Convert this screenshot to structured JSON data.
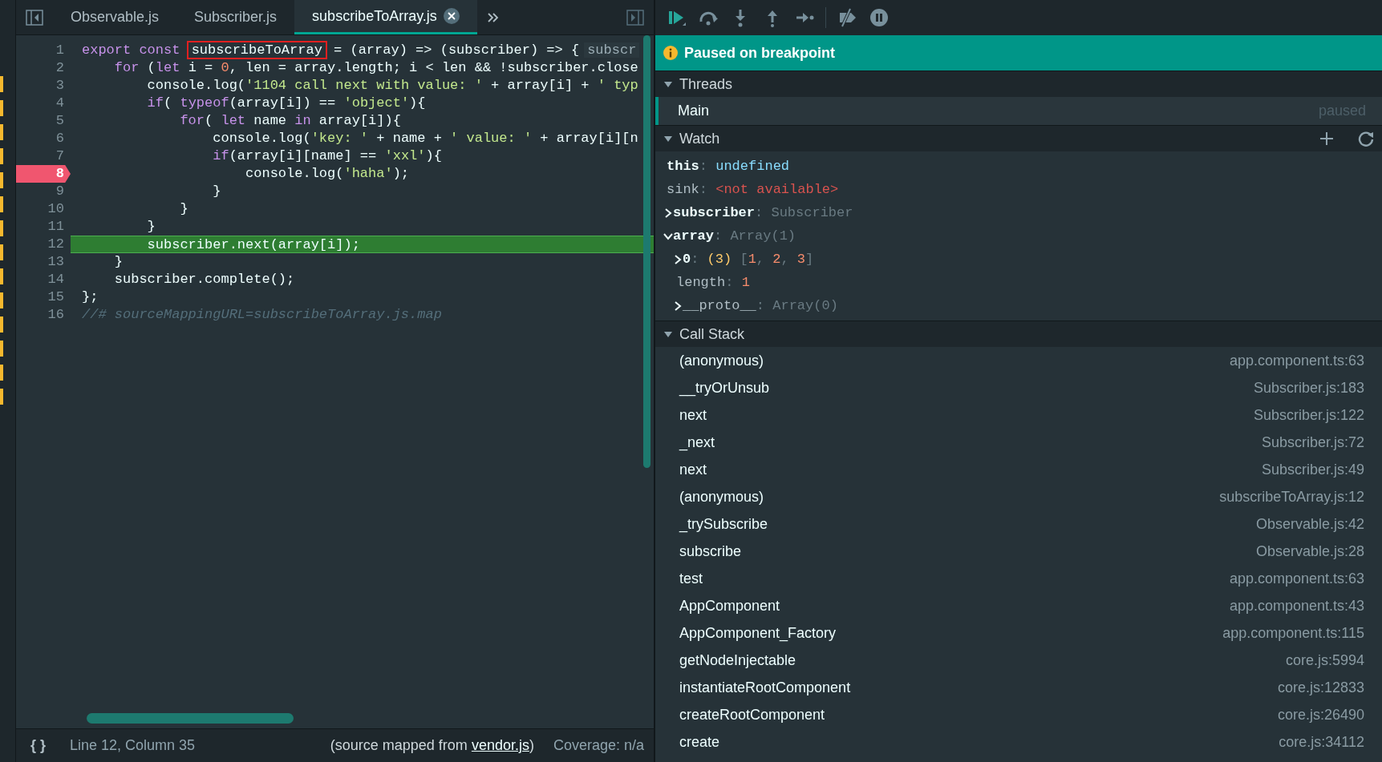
{
  "editor": {
    "tabs": [
      {
        "label": "Observable.js",
        "selected": false,
        "closable": false
      },
      {
        "label": "Subscriber.js",
        "selected": false,
        "closable": false
      },
      {
        "label": "subscribeToArray.js",
        "selected": true,
        "closable": true
      }
    ],
    "lines": [
      {
        "number": "1",
        "breakpoint": false,
        "current": false,
        "tokens": [
          {
            "kind": "keyword",
            "text": "export const "
          },
          {
            "kind": "boxed",
            "text": "subscribeToArray"
          },
          {
            "kind": "plain",
            "text": " = (array) => (subscriber) => {"
          },
          {
            "kind": "hint",
            "text": "subscr"
          }
        ]
      },
      {
        "number": "2",
        "breakpoint": false,
        "current": false,
        "tokens": [
          {
            "kind": "keyword",
            "text": "    for"
          },
          {
            "kind": "plain",
            "text": " ("
          },
          {
            "kind": "keyword",
            "text": "let"
          },
          {
            "kind": "plain",
            "text": " i = "
          },
          {
            "kind": "number",
            "text": "0"
          },
          {
            "kind": "plain",
            "text": ", len = array.length; i < len && !subscriber.close"
          }
        ]
      },
      {
        "number": "3",
        "breakpoint": false,
        "current": false,
        "tokens": [
          {
            "kind": "plain",
            "text": "        console.log("
          },
          {
            "kind": "string",
            "text": "'1104 call next with value: '"
          },
          {
            "kind": "plain",
            "text": " + array[i] + "
          },
          {
            "kind": "string",
            "text": "' typ"
          }
        ]
      },
      {
        "number": "4",
        "breakpoint": false,
        "current": false,
        "tokens": [
          {
            "kind": "keyword",
            "text": "        if"
          },
          {
            "kind": "plain",
            "text": "( "
          },
          {
            "kind": "keyword",
            "text": "typeof"
          },
          {
            "kind": "plain",
            "text": "(array[i]) == "
          },
          {
            "kind": "string",
            "text": "'object'"
          },
          {
            "kind": "plain",
            "text": "){"
          }
        ]
      },
      {
        "number": "5",
        "breakpoint": false,
        "current": false,
        "tokens": [
          {
            "kind": "keyword",
            "text": "            for"
          },
          {
            "kind": "plain",
            "text": "( "
          },
          {
            "kind": "keyword",
            "text": "let"
          },
          {
            "kind": "plain",
            "text": " name "
          },
          {
            "kind": "keyword",
            "text": "in"
          },
          {
            "kind": "plain",
            "text": " array[i]){"
          }
        ]
      },
      {
        "number": "6",
        "breakpoint": false,
        "current": false,
        "tokens": [
          {
            "kind": "plain",
            "text": "                console.log("
          },
          {
            "kind": "string",
            "text": "'key: '"
          },
          {
            "kind": "plain",
            "text": " + name + "
          },
          {
            "kind": "string",
            "text": "' value: '"
          },
          {
            "kind": "plain",
            "text": " + array[i][n"
          }
        ]
      },
      {
        "number": "7",
        "breakpoint": false,
        "current": false,
        "tokens": [
          {
            "kind": "keyword",
            "text": "                if"
          },
          {
            "kind": "plain",
            "text": "(array[i][name] == "
          },
          {
            "kind": "string",
            "text": "'xxl'"
          },
          {
            "kind": "plain",
            "text": "){"
          }
        ]
      },
      {
        "number": "8",
        "breakpoint": true,
        "current": false,
        "tokens": [
          {
            "kind": "plain",
            "text": "                    console.log("
          },
          {
            "kind": "string",
            "text": "'haha'"
          },
          {
            "kind": "plain",
            "text": ");"
          }
        ]
      },
      {
        "number": "9",
        "breakpoint": false,
        "current": false,
        "tokens": [
          {
            "kind": "plain",
            "text": "                }"
          }
        ]
      },
      {
        "number": "10",
        "breakpoint": false,
        "current": false,
        "tokens": [
          {
            "kind": "plain",
            "text": "            }"
          }
        ]
      },
      {
        "number": "11",
        "breakpoint": false,
        "current": false,
        "tokens": [
          {
            "kind": "plain",
            "text": "        }"
          }
        ]
      },
      {
        "number": "12",
        "breakpoint": false,
        "current": true,
        "tokens": [
          {
            "kind": "plain",
            "text": "        subscriber.next(array[i]);"
          }
        ]
      },
      {
        "number": "13",
        "breakpoint": false,
        "current": false,
        "tokens": [
          {
            "kind": "plain",
            "text": "    }"
          }
        ]
      },
      {
        "number": "14",
        "breakpoint": false,
        "current": false,
        "tokens": [
          {
            "kind": "plain",
            "text": "    subscriber.complete();"
          }
        ]
      },
      {
        "number": "15",
        "breakpoint": false,
        "current": false,
        "tokens": [
          {
            "kind": "plain",
            "text": "};"
          }
        ]
      },
      {
        "number": "16",
        "breakpoint": false,
        "current": false,
        "tokens": [
          {
            "kind": "comment",
            "text": "//# sourceMappingURL=subscribeToArray.js.map"
          }
        ]
      }
    ],
    "status_bar": {
      "format_button": "{ }",
      "position": "Line 12, Column 35",
      "source_prefix": "(source mapped from ",
      "source_link": "vendor.js",
      "source_suffix": ")",
      "coverage": "Coverage: n/a"
    }
  },
  "debugger": {
    "banner": "Paused on breakpoint",
    "threads": {
      "title": "Threads",
      "expanded": true,
      "items": [
        {
          "name": "Main",
          "status": "paused",
          "selected": true
        }
      ]
    },
    "watch": {
      "title": "Watch",
      "expanded": true,
      "items": [
        {
          "name": "this",
          "value": [
            {
              "kind": "punct",
              "text": ": "
            },
            {
              "kind": "undefined",
              "text": "undefined"
            }
          ]
        },
        {
          "name": "sink",
          "dim": true,
          "value": [
            {
              "kind": "punct",
              "text": ": "
            },
            {
              "kind": "error",
              "text": "<not available>"
            }
          ]
        },
        {
          "name": "subscriber",
          "expanded": false,
          "value": [
            {
              "kind": "punct",
              "text": ": "
            },
            {
              "kind": "type",
              "text": "Subscriber"
            }
          ]
        },
        {
          "name": "array",
          "expanded": true,
          "value": [
            {
              "kind": "punct",
              "text": ": "
            },
            {
              "kind": "type",
              "text": "Array(1)"
            }
          ],
          "children": [
            {
              "name": "0",
              "expanded": false,
              "value": [
                {
                  "kind": "punct",
                  "text": ": "
                },
                {
                  "kind": "count",
                  "text": "(3)"
                },
                {
                  "kind": "punct",
                  "text": " ["
                },
                {
                  "kind": "number",
                  "text": "1"
                },
                {
                  "kind": "punct",
                  "text": ", "
                },
                {
                  "kind": "number",
                  "text": "2"
                },
                {
                  "kind": "punct",
                  "text": ", "
                },
                {
                  "kind": "number",
                  "text": "3"
                },
                {
                  "kind": "punct",
                  "text": "]"
                }
              ]
            },
            {
              "name": "length",
              "dim": true,
              "value": [
                {
                  "kind": "punct",
                  "text": ": "
                },
                {
                  "kind": "number",
                  "text": "1"
                }
              ]
            },
            {
              "name": "__proto__",
              "expanded": false,
              "dim": true,
              "value": [
                {
                  "kind": "punct",
                  "text": ": "
                },
                {
                  "kind": "type",
                  "text": "Array(0)"
                }
              ]
            }
          ]
        }
      ]
    },
    "call_stack": {
      "title": "Call Stack",
      "expanded": true,
      "frames": [
        {
          "function": "(anonymous)",
          "location": "app.component.ts:63"
        },
        {
          "function": "__tryOrUnsub",
          "location": "Subscriber.js:183"
        },
        {
          "function": "next",
          "location": "Subscriber.js:122"
        },
        {
          "function": "_next",
          "location": "Subscriber.js:72"
        },
        {
          "function": "next",
          "location": "Subscriber.js:49"
        },
        {
          "function": "(anonymous)",
          "location": "subscribeToArray.js:12"
        },
        {
          "function": "_trySubscribe",
          "location": "Observable.js:42"
        },
        {
          "function": "subscribe",
          "location": "Observable.js:28"
        },
        {
          "function": "test",
          "location": "app.component.ts:63"
        },
        {
          "function": "AppComponent",
          "location": "app.component.ts:43"
        },
        {
          "function": "AppComponent_Factory",
          "location": "app.component.ts:115"
        },
        {
          "function": "getNodeInjectable",
          "location": "core.js:5994"
        },
        {
          "function": "instantiateRootComponent",
          "location": "core.js:12833"
        },
        {
          "function": "createRootComponent",
          "location": "core.js:26490"
        },
        {
          "function": "create",
          "location": "core.js:34112"
        }
      ]
    }
  }
}
